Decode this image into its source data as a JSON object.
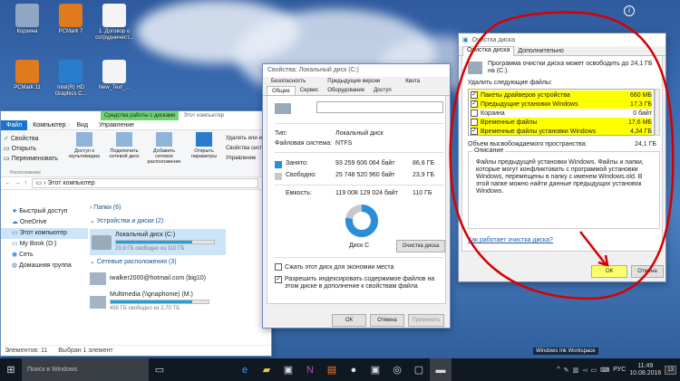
{
  "desktop": {
    "icons": [
      {
        "label": "Корзина",
        "color": "#8fa6c4"
      },
      {
        "label": "PCMark 7",
        "color": "#e07a1f"
      },
      {
        "label": "1. Договор о сотрудничест...",
        "color": "#f4f4f4"
      },
      {
        "label": "PCMark 11",
        "color": "#e07a1f"
      },
      {
        "label": "Intel(R) HD Graphics C...",
        "color": "#2a7ccc"
      },
      {
        "label": "New_Text_...",
        "color": "#f4f4f4"
      }
    ]
  },
  "explorer": {
    "ribbon_tab_context": "Средства работы с дисками",
    "title": "Этот компьютер",
    "tabs": [
      "Файл",
      "Компьютер",
      "Вид",
      "Управление"
    ],
    "ribbon_left": [
      "Свойства",
      "Открыть",
      "Переименовать"
    ],
    "ribbon_group": "Расположение",
    "ribbon_buttons": [
      "Доступ к мультимедиа",
      "Подключить сетевой диск",
      "Добавить сетевое расположение",
      "Открыть параметры"
    ],
    "ribbon_right": [
      "Удалить или изменить программу",
      "Свойства системы",
      "Управление"
    ],
    "address": "Этот компьютер",
    "nav": [
      "Быстрый доступ",
      "OneDrive",
      "Этот компьютер",
      "My Book (D:)",
      "Сеть",
      "Домашняя группа"
    ],
    "groups": [
      "Папки (6)",
      "Устройства и диски (2)",
      "Сетевые расположения (3)"
    ],
    "drive_name": "Локальный диск (C:)",
    "drive_free": "23,9 ГБ свободно из 110 ГБ",
    "drive_fill": 0.78,
    "net1": "iwalker2000@hotmail.com (big10)",
    "net2": "Multimedia (\\\\gnaphome) (M:)",
    "net2_free": "459 ГБ свободно из 2,70 ТБ",
    "net2_fill": 0.83,
    "status_items": "Элементов: 11",
    "status_selected": "Выбран 1 элемент"
  },
  "properties": {
    "title": "Свойства: Локальный диск (C:)",
    "tabs_row1": [
      "Безопасность",
      "Предыдущие версии",
      "Квота"
    ],
    "tabs_row2": [
      "Общие",
      "Сервис",
      "Оборудование",
      "Доступ"
    ],
    "type_label": "Тип:",
    "type_value": "Локальный диск",
    "fs_label": "Файловая система:",
    "fs_value": "NTFS",
    "used_label": "Занято:",
    "used_bytes": "93 259 606 064 байт",
    "used_gb": "86,8 ГБ",
    "free_label": "Свободно:",
    "free_bytes": "25 748 520 960 байт",
    "free_gb": "23,9 ГБ",
    "cap_label": "Емкость:",
    "cap_bytes": "119 008 129 024 байт",
    "cap_gb": "110 ГБ",
    "used_fraction": 0.78,
    "disk_label": "Диск С",
    "cleanup_button": "Очистка диска",
    "compress": "Сжать этот диск для экономии места",
    "index": "Разрешить индексировать содержимое файлов на этом диске в дополнение к свойствам файла",
    "ok": "ОК",
    "cancel": "Отмена",
    "apply": "Применить",
    "colors": {
      "used": "#2a8fd6",
      "free": "#c8c8c8"
    }
  },
  "cleanup": {
    "title": "Очистка диска",
    "tabs": [
      "Очистка диска",
      "Дополнительно"
    ],
    "intro": "Программа очистки диска может освободить до 24,1 ГБ на (C:).",
    "delete_label": "Удалить следующие файлы:",
    "files": [
      {
        "name": "Пакеты драйверов устройства",
        "size": "660 МБ",
        "checked": true,
        "hl": true
      },
      {
        "name": "Предыдущие установки Windows",
        "size": "17,3 ГБ",
        "checked": true,
        "hl": true
      },
      {
        "name": "Корзина",
        "size": "0 байт",
        "checked": false,
        "hl": false
      },
      {
        "name": "Временные файлы",
        "size": "17,6 МБ",
        "checked": false,
        "hl": true
      },
      {
        "name": "Временные файлы установки Windows",
        "size": "4,34 ГБ",
        "checked": true,
        "hl": true
      }
    ],
    "total_label": "Объем высвобождаемого пространства:",
    "total_value": "24,1 ГБ",
    "desc_label": "Описание",
    "description": "Файлы предыдущей установки Windows. Файлы и папки, которые могут конфликтовать с программой установки Windows, перемещены в папку с именем Windows.old. В этой папке можно найти данные предыдущих установок Windows.",
    "link": "Как работает очистка диска?",
    "ok": "ОК",
    "cancel": "Отмена"
  },
  "ink": "Windows Ink Workspace",
  "taskbar": {
    "search": "Поиск в Windows",
    "lang": "РУС",
    "time": "11:49",
    "date": "10.08.2016",
    "badge": "13"
  }
}
